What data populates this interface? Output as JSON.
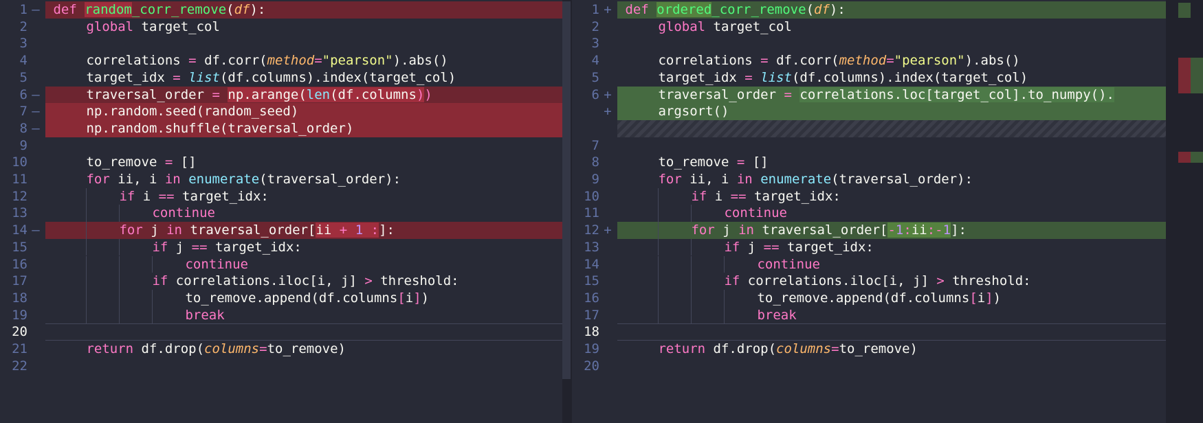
{
  "left": {
    "lines": [
      {
        "num": "1",
        "mark": "—",
        "tokens": [
          {
            "c": "kw",
            "t": "def "
          },
          {
            "c": "fn delw",
            "t": "random"
          },
          {
            "c": "fn",
            "t": "_corr_remove"
          },
          {
            "c": "pl",
            "t": "("
          },
          {
            "c": "pa",
            "t": "df"
          },
          {
            "c": "pl",
            "t": "):"
          }
        ],
        "state": "del",
        "indent": 0
      },
      {
        "num": "2",
        "mark": "",
        "tokens": [
          {
            "c": "kw",
            "t": "global "
          },
          {
            "c": "pl",
            "t": "target_col"
          }
        ],
        "state": "",
        "indent": 1
      },
      {
        "num": "3",
        "mark": "",
        "tokens": [],
        "state": "",
        "indent": 0
      },
      {
        "num": "4",
        "mark": "",
        "tokens": [
          {
            "c": "pl",
            "t": "correlations "
          },
          {
            "c": "op",
            "t": "="
          },
          {
            "c": "pl",
            "t": " df.corr("
          },
          {
            "c": "pa",
            "t": "method"
          },
          {
            "c": "op",
            "t": "="
          },
          {
            "c": "st",
            "t": "\"pearson\""
          },
          {
            "c": "pl",
            "t": ").abs()"
          }
        ],
        "state": "",
        "indent": 1
      },
      {
        "num": "5",
        "mark": "",
        "tokens": [
          {
            "c": "pl",
            "t": "target_idx "
          },
          {
            "c": "op",
            "t": "="
          },
          {
            "c": "pl",
            "t": " "
          },
          {
            "c": "bi",
            "t": "list"
          },
          {
            "c": "pl",
            "t": "(df.columns).index(target_col)"
          }
        ],
        "state": "",
        "indent": 1
      },
      {
        "num": "6",
        "mark": "—",
        "tokens": [
          {
            "c": "pl",
            "t": "traversal_order "
          },
          {
            "c": "op",
            "t": "="
          },
          {
            "c": "pl",
            "t": " "
          },
          {
            "c": "pl delw",
            "t": "np.arange("
          },
          {
            "c": "cy delw",
            "t": "len"
          },
          {
            "c": "pl delw",
            "t": "(df.columns"
          },
          {
            "c": "op delw",
            "t": ")"
          },
          {
            "c": "op",
            "t": ")"
          }
        ],
        "state": "del",
        "indent": 1
      },
      {
        "num": "7",
        "mark": "—",
        "tokens": [
          {
            "c": "pl",
            "t": "np.random.seed(random_seed)"
          }
        ],
        "state": "delhl",
        "indent": 1
      },
      {
        "num": "8",
        "mark": "—",
        "tokens": [
          {
            "c": "pl",
            "t": "np.random.shuffle(traversal_order)"
          }
        ],
        "state": "delhl",
        "indent": 1
      },
      {
        "num": "9",
        "mark": "",
        "tokens": [],
        "state": "",
        "indent": 0
      },
      {
        "num": "10",
        "mark": "",
        "tokens": [
          {
            "c": "pl",
            "t": "to_remove "
          },
          {
            "c": "op",
            "t": "="
          },
          {
            "c": "pl",
            "t": " []"
          }
        ],
        "state": "",
        "indent": 1
      },
      {
        "num": "11",
        "mark": "",
        "tokens": [
          {
            "c": "kw",
            "t": "for "
          },
          {
            "c": "pl",
            "t": "ii, i "
          },
          {
            "c": "kw",
            "t": "in "
          },
          {
            "c": "cy",
            "t": "enumerate"
          },
          {
            "c": "pl",
            "t": "(traversal_order):"
          }
        ],
        "state": "",
        "indent": 1
      },
      {
        "num": "12",
        "mark": "",
        "tokens": [
          {
            "c": "kw",
            "t": "if "
          },
          {
            "c": "pl",
            "t": "i "
          },
          {
            "c": "op",
            "t": "=="
          },
          {
            "c": "pl",
            "t": " target_idx:"
          }
        ],
        "state": "",
        "indent": 2
      },
      {
        "num": "13",
        "mark": "",
        "tokens": [
          {
            "c": "kw",
            "t": "continue"
          }
        ],
        "state": "",
        "indent": 3
      },
      {
        "num": "14",
        "mark": "—",
        "tokens": [
          {
            "c": "kw",
            "t": "for "
          },
          {
            "c": "pl",
            "t": "j "
          },
          {
            "c": "kw",
            "t": "in "
          },
          {
            "c": "pl",
            "t": "traversal_order["
          },
          {
            "c": "pl delw",
            "t": "ii "
          },
          {
            "c": "op delw",
            "t": "+"
          },
          {
            "c": "pl delw",
            "t": " "
          },
          {
            "c": "nm delw",
            "t": "1"
          },
          {
            "c": "pl delw",
            "t": " "
          },
          {
            "c": "op delw",
            "t": ":"
          },
          {
            "c": "pl",
            "t": "]:"
          }
        ],
        "state": "del",
        "indent": 2
      },
      {
        "num": "15",
        "mark": "",
        "tokens": [
          {
            "c": "kw",
            "t": "if "
          },
          {
            "c": "pl",
            "t": "j "
          },
          {
            "c": "op",
            "t": "=="
          },
          {
            "c": "pl",
            "t": " target_idx:"
          }
        ],
        "state": "",
        "indent": 3
      },
      {
        "num": "16",
        "mark": "",
        "tokens": [
          {
            "c": "kw",
            "t": "continue"
          }
        ],
        "state": "",
        "indent": 4
      },
      {
        "num": "17",
        "mark": "",
        "tokens": [
          {
            "c": "kw",
            "t": "if "
          },
          {
            "c": "pl",
            "t": "correlations.iloc[i, j] "
          },
          {
            "c": "op",
            "t": ">"
          },
          {
            "c": "pl",
            "t": " threshold:"
          }
        ],
        "state": "",
        "indent": 3
      },
      {
        "num": "18",
        "mark": "",
        "tokens": [
          {
            "c": "pl",
            "t": "to_remove.append(df.columns"
          },
          {
            "c": "op",
            "t": "["
          },
          {
            "c": "pl",
            "t": "i"
          },
          {
            "c": "op",
            "t": "]"
          },
          {
            "c": "pl",
            "t": ")"
          }
        ],
        "state": "",
        "indent": 4
      },
      {
        "num": "19",
        "mark": "",
        "tokens": [
          {
            "c": "kw",
            "t": "break"
          }
        ],
        "state": "",
        "indent": 4
      },
      {
        "num": "20",
        "mark": "",
        "tokens": [],
        "state": "cur",
        "indent": 0
      },
      {
        "num": "21",
        "mark": "",
        "tokens": [
          {
            "c": "kw",
            "t": "return "
          },
          {
            "c": "pl",
            "t": "df.drop("
          },
          {
            "c": "pa",
            "t": "columns"
          },
          {
            "c": "op",
            "t": "="
          },
          {
            "c": "pl",
            "t": "to_remove)"
          }
        ],
        "state": "",
        "indent": 1
      },
      {
        "num": "22",
        "mark": "",
        "tokens": [],
        "state": "",
        "indent": 0
      }
    ]
  },
  "right": {
    "lines": [
      {
        "num": "1",
        "mark": "+",
        "tokens": [
          {
            "c": "kw",
            "t": "def "
          },
          {
            "c": "fn addw",
            "t": "ordered"
          },
          {
            "c": "fn",
            "t": "_corr_remove"
          },
          {
            "c": "pl",
            "t": "("
          },
          {
            "c": "pa",
            "t": "df"
          },
          {
            "c": "pl",
            "t": "):"
          }
        ],
        "state": "add",
        "indent": 0
      },
      {
        "num": "2",
        "mark": "",
        "tokens": [
          {
            "c": "kw",
            "t": "global "
          },
          {
            "c": "pl",
            "t": "target_col"
          }
        ],
        "state": "",
        "indent": 1
      },
      {
        "num": "3",
        "mark": "",
        "tokens": [],
        "state": "",
        "indent": 0
      },
      {
        "num": "4",
        "mark": "",
        "tokens": [
          {
            "c": "pl",
            "t": "correlations "
          },
          {
            "c": "op",
            "t": "="
          },
          {
            "c": "pl",
            "t": " df.corr("
          },
          {
            "c": "pa",
            "t": "method"
          },
          {
            "c": "op",
            "t": "="
          },
          {
            "c": "st",
            "t": "\"pearson\""
          },
          {
            "c": "pl",
            "t": ").abs()"
          }
        ],
        "state": "",
        "indent": 1
      },
      {
        "num": "5",
        "mark": "",
        "tokens": [
          {
            "c": "pl",
            "t": "target_idx "
          },
          {
            "c": "op",
            "t": "="
          },
          {
            "c": "pl",
            "t": " "
          },
          {
            "c": "bi",
            "t": "list"
          },
          {
            "c": "pl",
            "t": "(df.columns).index(target_col)"
          }
        ],
        "state": "",
        "indent": 1
      },
      {
        "num": "6",
        "mark": "+",
        "tokens": [
          {
            "c": "pl",
            "t": "traversal_order "
          },
          {
            "c": "op",
            "t": "="
          },
          {
            "c": "pl",
            "t": " "
          },
          {
            "c": "pl addw2",
            "t": "correlations.loc[target_col].to_numpy()."
          }
        ],
        "state": "addhl",
        "indent": 1
      },
      {
        "num": "",
        "mark": "+",
        "tokens": [
          {
            "c": "pl",
            "t": "argsort()"
          }
        ],
        "state": "addhl",
        "indent": 1
      },
      {
        "num": "",
        "mark": "",
        "tokens": [],
        "state": "hatch",
        "indent": 0
      },
      {
        "num": "7",
        "mark": "",
        "tokens": [],
        "state": "",
        "indent": 0
      },
      {
        "num": "8",
        "mark": "",
        "tokens": [
          {
            "c": "pl",
            "t": "to_remove "
          },
          {
            "c": "op",
            "t": "="
          },
          {
            "c": "pl",
            "t": " []"
          }
        ],
        "state": "",
        "indent": 1
      },
      {
        "num": "9",
        "mark": "",
        "tokens": [
          {
            "c": "kw",
            "t": "for "
          },
          {
            "c": "pl",
            "t": "ii, i "
          },
          {
            "c": "kw",
            "t": "in "
          },
          {
            "c": "cy",
            "t": "enumerate"
          },
          {
            "c": "pl",
            "t": "(traversal_order):"
          }
        ],
        "state": "",
        "indent": 1
      },
      {
        "num": "10",
        "mark": "",
        "tokens": [
          {
            "c": "kw",
            "t": "if "
          },
          {
            "c": "pl",
            "t": "i "
          },
          {
            "c": "op",
            "t": "=="
          },
          {
            "c": "pl",
            "t": " target_idx:"
          }
        ],
        "state": "",
        "indent": 2
      },
      {
        "num": "11",
        "mark": "",
        "tokens": [
          {
            "c": "kw",
            "t": "continue"
          }
        ],
        "state": "",
        "indent": 3
      },
      {
        "num": "12",
        "mark": "+",
        "tokens": [
          {
            "c": "kw",
            "t": "for "
          },
          {
            "c": "pl",
            "t": "j "
          },
          {
            "c": "kw",
            "t": "in "
          },
          {
            "c": "pl",
            "t": "traversal_order["
          },
          {
            "c": "op addw",
            "t": "-"
          },
          {
            "c": "nm addw",
            "t": "1"
          },
          {
            "c": "op addw",
            "t": ":"
          },
          {
            "c": "pl addw",
            "t": "ii"
          },
          {
            "c": "op addw",
            "t": ":-"
          },
          {
            "c": "nm addw",
            "t": "1"
          },
          {
            "c": "pl",
            "t": "]:"
          }
        ],
        "state": "add",
        "indent": 2
      },
      {
        "num": "13",
        "mark": "",
        "tokens": [
          {
            "c": "kw",
            "t": "if "
          },
          {
            "c": "pl",
            "t": "j "
          },
          {
            "c": "op",
            "t": "=="
          },
          {
            "c": "pl",
            "t": " target_idx:"
          }
        ],
        "state": "",
        "indent": 3
      },
      {
        "num": "14",
        "mark": "",
        "tokens": [
          {
            "c": "kw",
            "t": "continue"
          }
        ],
        "state": "",
        "indent": 4
      },
      {
        "num": "15",
        "mark": "",
        "tokens": [
          {
            "c": "kw",
            "t": "if "
          },
          {
            "c": "pl",
            "t": "correlations.iloc[i, j] "
          },
          {
            "c": "op",
            "t": ">"
          },
          {
            "c": "pl",
            "t": " threshold:"
          }
        ],
        "state": "",
        "indent": 3
      },
      {
        "num": "16",
        "mark": "",
        "tokens": [
          {
            "c": "pl",
            "t": "to_remove.append(df.columns"
          },
          {
            "c": "op",
            "t": "["
          },
          {
            "c": "pl",
            "t": "i"
          },
          {
            "c": "op",
            "t": "]"
          },
          {
            "c": "pl",
            "t": ")"
          }
        ],
        "state": "",
        "indent": 4
      },
      {
        "num": "17",
        "mark": "",
        "tokens": [
          {
            "c": "kw",
            "t": "break"
          }
        ],
        "state": "",
        "indent": 4
      },
      {
        "num": "18",
        "mark": "",
        "tokens": [],
        "state": "cur",
        "indent": 0
      },
      {
        "num": "19",
        "mark": "",
        "tokens": [
          {
            "c": "kw",
            "t": "return "
          },
          {
            "c": "pl",
            "t": "df.drop("
          },
          {
            "c": "pa",
            "t": "columns"
          },
          {
            "c": "op",
            "t": "="
          },
          {
            "c": "pl",
            "t": "to_remove)"
          }
        ],
        "state": "",
        "indent": 1
      },
      {
        "num": "20",
        "mark": "",
        "tokens": [],
        "state": "",
        "indent": 0
      }
    ]
  },
  "arrows": [
    {
      "row": 1,
      "glyph": "→"
    },
    {
      "row": 6,
      "glyph": "→"
    },
    {
      "row": 14,
      "glyph": "→"
    }
  ],
  "colors": {
    "deleted_bg": "#6d2530",
    "added_bg": "#3e5a3a",
    "editor_bg": "#282a36"
  }
}
